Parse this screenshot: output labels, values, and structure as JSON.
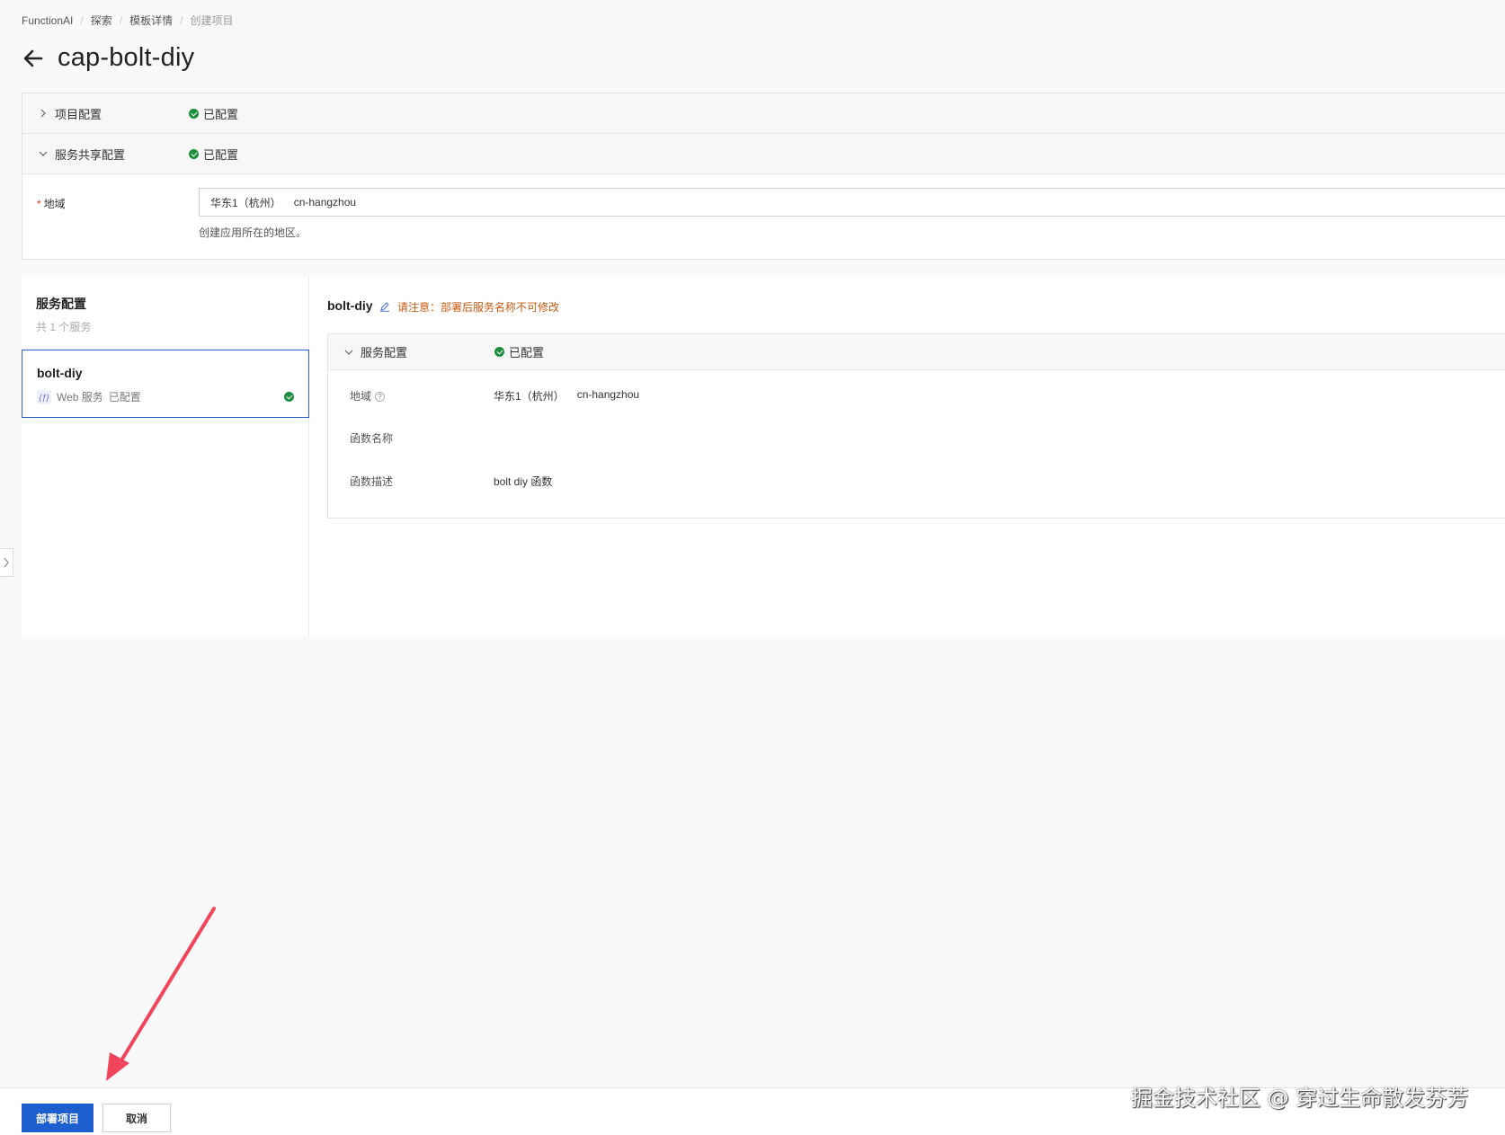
{
  "breadcrumb": [
    "FunctionAI",
    "探索",
    "模板详情",
    "创建项目"
  ],
  "page_title": "cap-bolt-diy",
  "shared_config": {
    "project_config_label": "项目配置",
    "project_config_status": "已配置",
    "shared_config_label": "服务共享配置",
    "shared_config_status": "已配置",
    "region_label": "地域",
    "region_value": "华东1（杭州）",
    "region_code": "cn-hangzhou",
    "region_help": "创建应用所在的地区。"
  },
  "services": {
    "title": "服务配置",
    "count": "共 1 个服务",
    "items": [
      {
        "name": "bolt-diy",
        "type": "Web 服务",
        "status": "已配置"
      }
    ]
  },
  "detail": {
    "service_name": "bolt-diy",
    "warning": "请注意：部署后服务名称不可修改",
    "section_label": "服务配置",
    "section_status": "已配置",
    "region_label": "地域",
    "region_value": "华东1（杭州）",
    "region_code": "cn-hangzhou",
    "function_name_label": "函数名称",
    "function_name_value": "",
    "function_desc_label": "函数描述",
    "function_desc_value": "bolt diy 函数"
  },
  "footer": {
    "deploy_label": "部署项目",
    "cancel_label": "取消"
  },
  "watermark": "掘金技术社区 @ 穿过生命散发芬芳",
  "colors": {
    "primary": "#1e5fcf",
    "success": "#1e8e3e",
    "warning": "#c85a10",
    "annotation_arrow": "#f0455a"
  }
}
